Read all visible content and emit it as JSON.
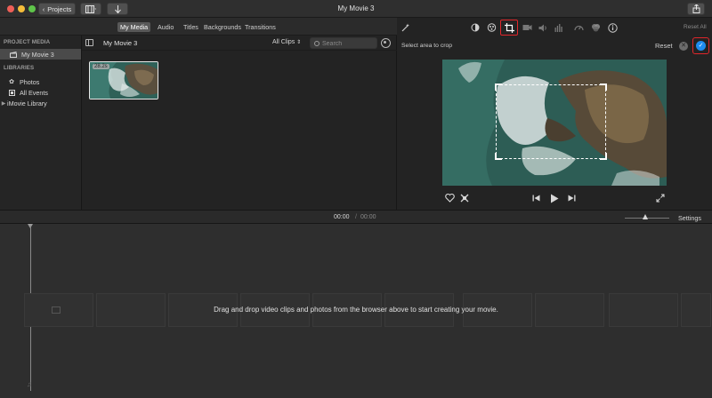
{
  "window": {
    "title": "My Movie 3",
    "projects_label": "Projects"
  },
  "tabs": {
    "items": [
      "My Media",
      "Audio",
      "Titles",
      "Backgrounds",
      "Transitions"
    ]
  },
  "sidebar": {
    "project_media_header": "PROJECT MEDIA",
    "project_item": "My Movie 3",
    "libraries_header": "LIBRARIES",
    "photos": "Photos",
    "all_events": "All Events",
    "imovie_library": "iMovie Library"
  },
  "browser": {
    "title": "My Movie 3",
    "filter": "All Clips",
    "search_placeholder": "Search",
    "clip_duration": "28.2s"
  },
  "viewer": {
    "reset_all": "Reset All",
    "crop_prompt": "Select area to crop",
    "reset": "Reset",
    "toolbar_icons": [
      "magic-wand-icon",
      "color-balance-icon",
      "color-correction-icon",
      "crop-icon",
      "stabilization-icon",
      "volume-icon",
      "noise-reduction-icon",
      "speed-icon",
      "clip-filter-icon",
      "info-icon"
    ]
  },
  "timeline": {
    "current_time": "00:00",
    "separator": "/",
    "total_time": "00:00",
    "settings": "Settings",
    "drop_message": "Drag and drop video clips and photos from the browser above to start creating your movie."
  },
  "colors": {
    "accent_blue": "#1e8cf0",
    "highlight_red": "#e0262b",
    "background": "#232323"
  }
}
